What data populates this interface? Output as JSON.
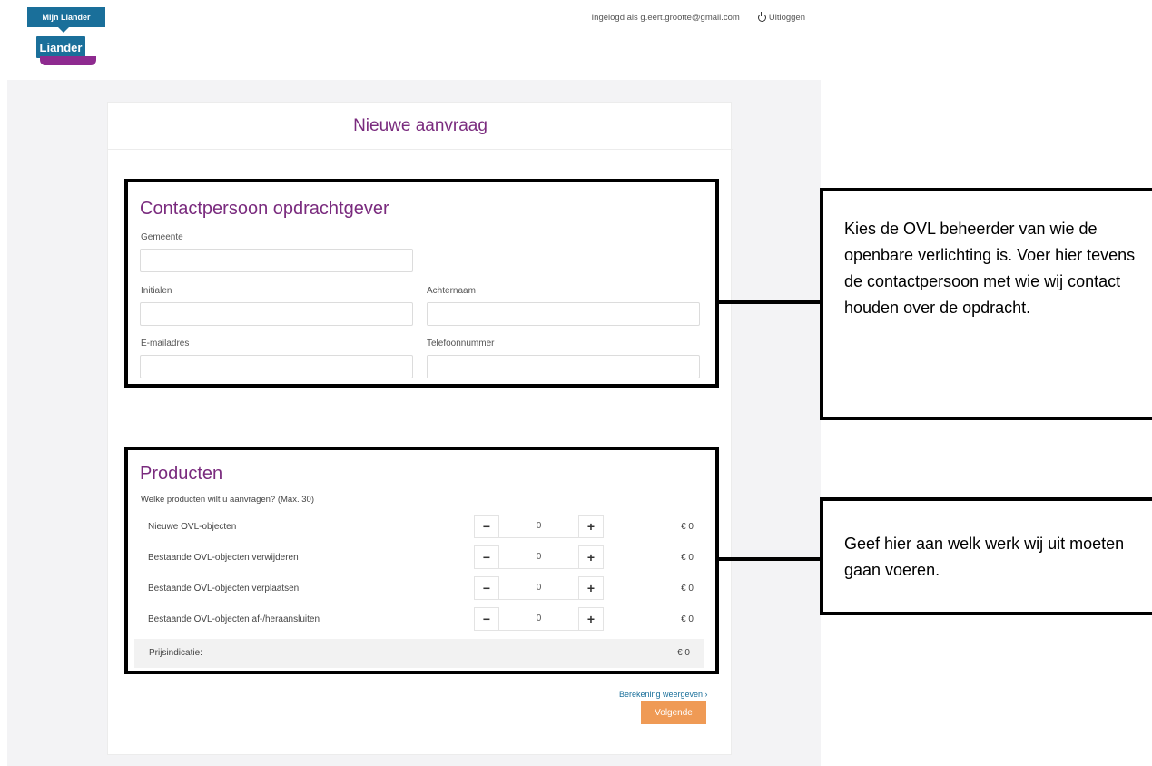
{
  "header": {
    "brand_badge": "Mijn Liander",
    "logo_text": "Liander",
    "logged_in_text": "Ingelogd als g.eert.grootte@gmail.com",
    "logout_label": "Uitloggen"
  },
  "card": {
    "title": "Nieuwe aanvraag"
  },
  "contact": {
    "title": "Contactpersoon opdrachtgever",
    "fields": {
      "gemeente": {
        "label": "Gemeente",
        "value": ""
      },
      "initialen": {
        "label": "Initialen",
        "value": ""
      },
      "achternaam": {
        "label": "Achternaam",
        "value": ""
      },
      "email": {
        "label": "E-mailadres",
        "value": ""
      },
      "telefoon": {
        "label": "Telefoonnummer",
        "value": ""
      }
    }
  },
  "products": {
    "title": "Producten",
    "question": "Welke producten wilt u aanvragen? (Max. 30)",
    "items": [
      {
        "label": "Nieuwe OVL-objecten",
        "quantity": "0",
        "price": "€ 0"
      },
      {
        "label": "Bestaande OVL-objecten verwijderen",
        "quantity": "0",
        "price": "€ 0"
      },
      {
        "label": "Bestaande OVL-objecten verplaatsen",
        "quantity": "0",
        "price": "€ 0"
      },
      {
        "label": "Bestaande OVL-objecten af-/heraansluiten",
        "quantity": "0",
        "price": "€ 0"
      }
    ],
    "minus": "−",
    "plus": "+",
    "total_label": "Prijsindicatie:",
    "total_price": "€ 0"
  },
  "actions": {
    "calc_link": "Berekening weergeven ›",
    "next_label": "Volgende"
  },
  "callouts": {
    "contact_note": "Kies de OVL beheerder van wie de openbare verlichting is. Voer hier tevens de contactpersoon met wie wij contact houden over de opdracht.",
    "products_note": "Geef hier aan welk werk wij uit moeten gaan voeren."
  },
  "colors": {
    "brand_blue": "#1a6f9a",
    "brand_purple": "#7a2b7e",
    "accent_orange": "#ef9a55"
  },
  "icons": {
    "logout": "power-icon",
    "decrement": "minus-icon",
    "increment": "plus-icon"
  }
}
